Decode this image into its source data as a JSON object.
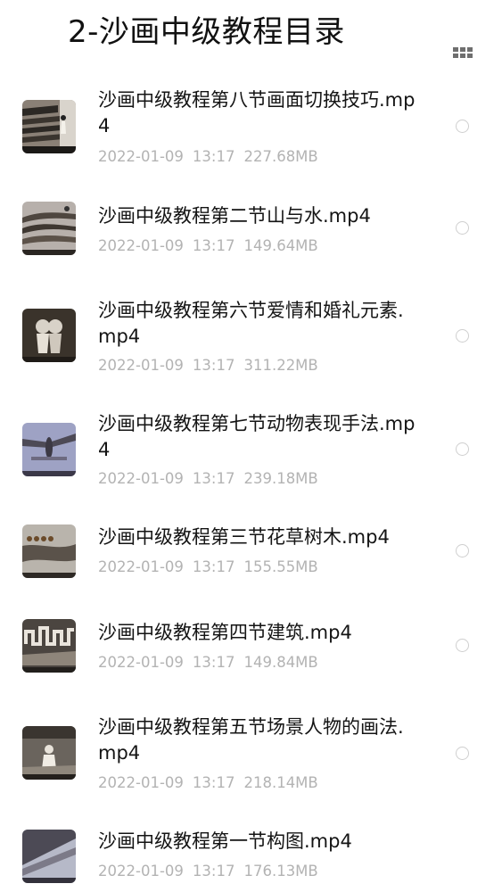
{
  "header": {
    "title": "2-沙画中级教程目录",
    "view_toggle_icon": "grid-view-icon"
  },
  "colors": {
    "text_primary": "#141414",
    "text_meta": "#b3b3b3",
    "radio_border": "#cfcfcf",
    "background": "#ffffff"
  },
  "files": [
    {
      "name": "沙画中级教程第八节画面切换技巧.mp4",
      "date": "2022-01-09",
      "time": "13:17",
      "size": "227.68MB",
      "thumb_icon": "video-thumbnail-icon"
    },
    {
      "name": "沙画中级教程第二节山与水.mp4",
      "date": "2022-01-09",
      "time": "13:17",
      "size": "149.64MB",
      "thumb_icon": "video-thumbnail-icon"
    },
    {
      "name": "沙画中级教程第六节爱情和婚礼元素.mp4",
      "date": "2022-01-09",
      "time": "13:17",
      "size": "311.22MB",
      "thumb_icon": "video-thumbnail-icon"
    },
    {
      "name": "沙画中级教程第七节动物表现手法.mp4",
      "date": "2022-01-09",
      "time": "13:17",
      "size": "239.18MB",
      "thumb_icon": "video-thumbnail-icon"
    },
    {
      "name": "沙画中级教程第三节花草树木.mp4",
      "date": "2022-01-09",
      "time": "13:17",
      "size": "155.55MB",
      "thumb_icon": "video-thumbnail-icon"
    },
    {
      "name": "沙画中级教程第四节建筑.mp4",
      "date": "2022-01-09",
      "time": "13:17",
      "size": "149.84MB",
      "thumb_icon": "video-thumbnail-icon"
    },
    {
      "name": "沙画中级教程第五节场景人物的画法.mp4",
      "date": "2022-01-09",
      "time": "13:17",
      "size": "218.14MB",
      "thumb_icon": "video-thumbnail-icon"
    },
    {
      "name": "沙画中级教程第一节构图.mp4",
      "date": "2022-01-09",
      "time": "13:17",
      "size": "176.13MB",
      "thumb_icon": "video-thumbnail-icon"
    }
  ]
}
